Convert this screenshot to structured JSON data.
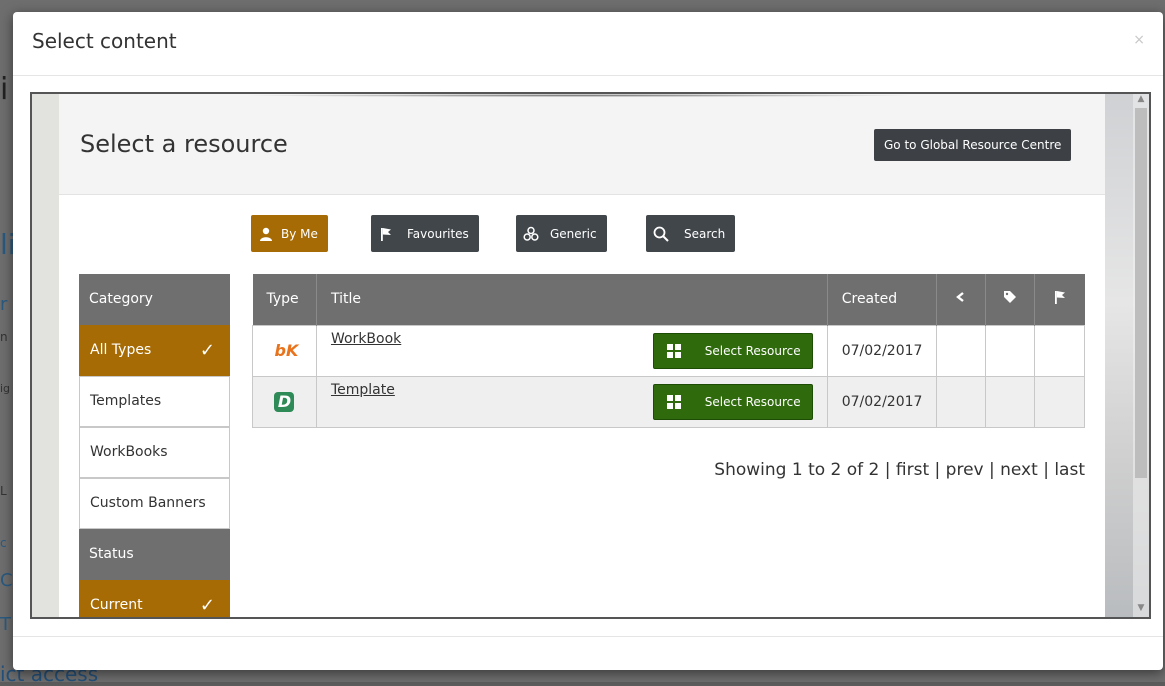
{
  "background": {
    "fragments": [
      "i",
      "li",
      "r",
      "n",
      "ig",
      "L",
      "c",
      "C",
      "T"
    ],
    "bottom_text": "ict access"
  },
  "modal": {
    "title": "Select content",
    "close_glyph": "×"
  },
  "panel": {
    "title": "Select a resource",
    "global_button": "Go to Global Resource Centre"
  },
  "filters": [
    {
      "label": "By Me",
      "icon": "user-icon",
      "active": true
    },
    {
      "label": "Favourites",
      "icon": "flag-icon",
      "active": false
    },
    {
      "label": "Generic",
      "icon": "generic-icon",
      "active": false
    },
    {
      "label": "Search",
      "icon": "search-icon",
      "active": false
    }
  ],
  "sidebar": {
    "category_header": "Category",
    "category_items": [
      {
        "label": "All Types",
        "selected": true
      },
      {
        "label": "Templates",
        "selected": false
      },
      {
        "label": "WorkBooks",
        "selected": false
      },
      {
        "label": "Custom Banners",
        "selected": false
      }
    ],
    "status_header": "Status",
    "status_items": [
      {
        "label": "Current",
        "selected": true
      }
    ],
    "check_glyph": "✓"
  },
  "table": {
    "columns": {
      "type": "Type",
      "title": "Title",
      "created": "Created"
    },
    "rows": [
      {
        "type_icon": "workbook-icon",
        "type_glyph": "bK",
        "title": "WorkBook",
        "button": "Select Resource",
        "created": "07/02/2017"
      },
      {
        "type_icon": "template-icon",
        "type_glyph": "D",
        "title": "Template",
        "button": "Select Resource",
        "created": "07/02/2017"
      }
    ]
  },
  "pager": {
    "text": "Showing 1 to 2 of 2 | first | prev | next | last"
  },
  "colors": {
    "accent": "#a66b04",
    "select_green": "#2f6b0d",
    "dark_button": "#41464b",
    "header_gray": "#6f6f6f"
  }
}
